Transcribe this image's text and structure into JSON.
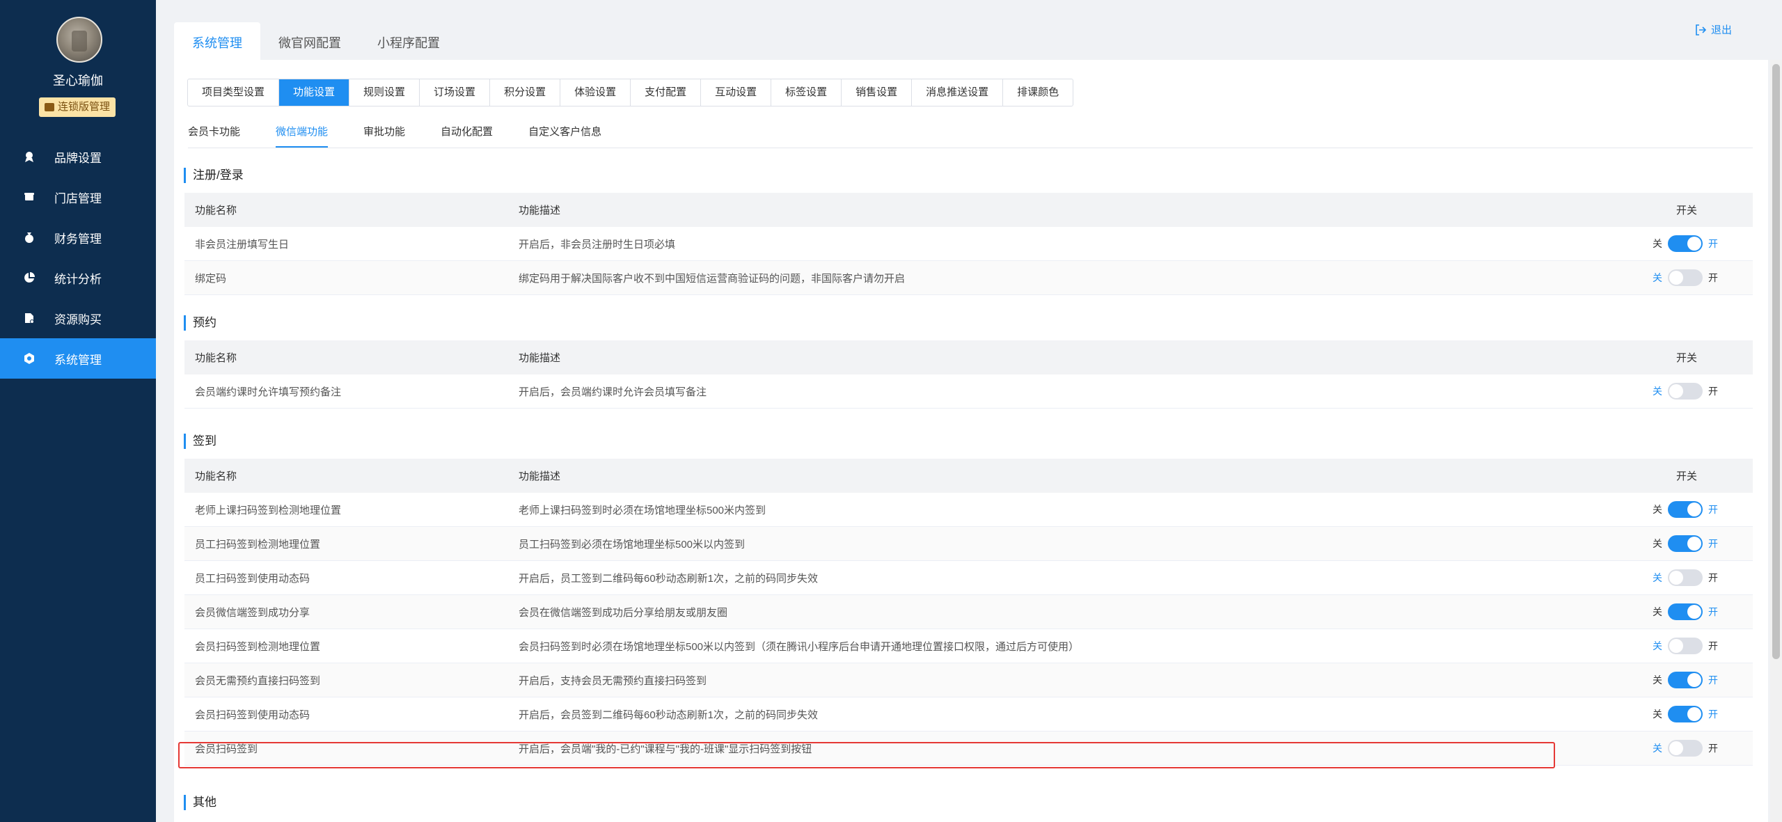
{
  "sidebar": {
    "shop_name": "圣心瑜伽",
    "badge": "连锁版管理",
    "items": [
      {
        "label": "品牌设置",
        "icon": "brand-icon"
      },
      {
        "label": "门店管理",
        "icon": "store-icon"
      },
      {
        "label": "财务管理",
        "icon": "money-bag-icon"
      },
      {
        "label": "统计分析",
        "icon": "pie-chart-icon"
      },
      {
        "label": "资源购买",
        "icon": "purchase-icon"
      },
      {
        "label": "系统管理",
        "icon": "settings-icon"
      }
    ],
    "active_index": 5
  },
  "top_tabs": [
    "系统管理",
    "微官网配置",
    "小程序配置"
  ],
  "logout": "退出",
  "setting_tabs": [
    "项目类型设置",
    "功能设置",
    "规则设置",
    "订场设置",
    "积分设置",
    "体验设置",
    "支付配置",
    "互动设置",
    "标签设置",
    "销售设置",
    "消息推送设置",
    "排课颜色"
  ],
  "function_tabs": [
    "会员卡功能",
    "微信端功能",
    "审批功能",
    "自动化配置",
    "自定义客户信息"
  ],
  "table_headers": {
    "name": "功能名称",
    "desc": "功能描述",
    "switch": "开关"
  },
  "switch_labels": {
    "off": "关",
    "on": "开"
  },
  "sections": [
    {
      "title": "注册/登录",
      "rows": [
        {
          "name": "非会员注册填写生日",
          "desc": "开启后，非会员注册时生日项必填",
          "on": true
        },
        {
          "name": "绑定码",
          "desc": "绑定码用于解决国际客户收不到中国短信运营商验证码的问题，非国际客户请勿开启",
          "on": false
        }
      ]
    },
    {
      "title": "预约",
      "rows": [
        {
          "name": "会员端约课时允许填写预约备注",
          "desc": "开启后，会员端约课时允许会员填写备注",
          "on": false
        }
      ]
    },
    {
      "title": "签到",
      "rows": [
        {
          "name": "老师上课扫码签到检测地理位置",
          "desc": "老师上课扫码签到时必须在场馆地理坐标500米内签到",
          "on": true
        },
        {
          "name": "员工扫码签到检测地理位置",
          "desc": "员工扫码签到必须在场馆地理坐标500米以内签到",
          "on": true
        },
        {
          "name": "员工扫码签到使用动态码",
          "desc": "开启后，员工签到二维码每60秒动态刷新1次，之前的码同步失效",
          "on": false
        },
        {
          "name": "会员微信端签到成功分享",
          "desc": "会员在微信端签到成功后分享给朋友或朋友圈",
          "on": true
        },
        {
          "name": "会员扫码签到检测地理位置",
          "desc": "会员扫码签到时必须在场馆地理坐标500米以内签到（须在腾讯小程序后台申请开通地理位置接口权限，通过后方可使用）",
          "on": false
        },
        {
          "name": "会员无需预约直接扫码签到",
          "desc": "开启后，支持会员无需预约直接扫码签到",
          "on": true
        },
        {
          "name": "会员扫码签到使用动态码",
          "desc": "开启后，会员签到二维码每60秒动态刷新1次，之前的码同步失效",
          "on": true
        },
        {
          "name": "会员扫码签到",
          "desc": "开启后，会员端\"我的-已约\"课程与\"我的-班课\"显示扫码签到按钮",
          "on": false
        }
      ]
    },
    {
      "title": "其他",
      "rows": []
    }
  ],
  "colors": {
    "sidebar": "#0d2d4f",
    "accent": "#1f8ef1",
    "highlight": "#e53935"
  }
}
